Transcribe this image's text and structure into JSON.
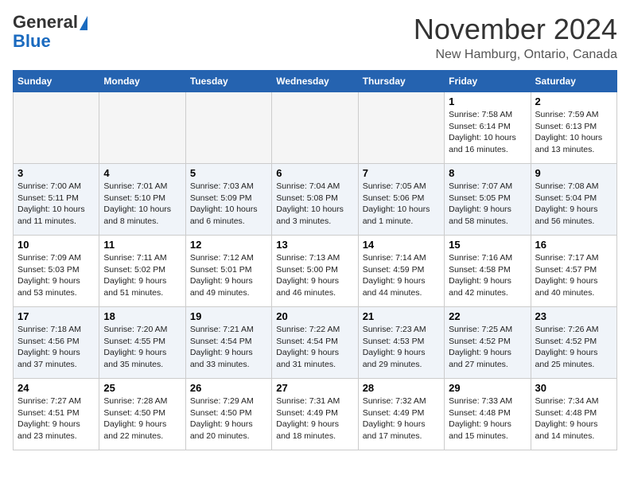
{
  "header": {
    "logo_line1": "General",
    "logo_line2": "Blue",
    "month": "November 2024",
    "location": "New Hamburg, Ontario, Canada"
  },
  "weekdays": [
    "Sunday",
    "Monday",
    "Tuesday",
    "Wednesday",
    "Thursday",
    "Friday",
    "Saturday"
  ],
  "weeks": [
    {
      "rowStyle": "row-white",
      "days": [
        {
          "num": "",
          "info": "",
          "empty": true
        },
        {
          "num": "",
          "info": "",
          "empty": true
        },
        {
          "num": "",
          "info": "",
          "empty": true
        },
        {
          "num": "",
          "info": "",
          "empty": true
        },
        {
          "num": "",
          "info": "",
          "empty": true
        },
        {
          "num": "1",
          "info": "Sunrise: 7:58 AM\nSunset: 6:14 PM\nDaylight: 10 hours\nand 16 minutes.",
          "empty": false
        },
        {
          "num": "2",
          "info": "Sunrise: 7:59 AM\nSunset: 6:13 PM\nDaylight: 10 hours\nand 13 minutes.",
          "empty": false
        }
      ]
    },
    {
      "rowStyle": "row-blue",
      "days": [
        {
          "num": "3",
          "info": "Sunrise: 7:00 AM\nSunset: 5:11 PM\nDaylight: 10 hours\nand 11 minutes.",
          "empty": false
        },
        {
          "num": "4",
          "info": "Sunrise: 7:01 AM\nSunset: 5:10 PM\nDaylight: 10 hours\nand 8 minutes.",
          "empty": false
        },
        {
          "num": "5",
          "info": "Sunrise: 7:03 AM\nSunset: 5:09 PM\nDaylight: 10 hours\nand 6 minutes.",
          "empty": false
        },
        {
          "num": "6",
          "info": "Sunrise: 7:04 AM\nSunset: 5:08 PM\nDaylight: 10 hours\nand 3 minutes.",
          "empty": false
        },
        {
          "num": "7",
          "info": "Sunrise: 7:05 AM\nSunset: 5:06 PM\nDaylight: 10 hours\nand 1 minute.",
          "empty": false
        },
        {
          "num": "8",
          "info": "Sunrise: 7:07 AM\nSunset: 5:05 PM\nDaylight: 9 hours\nand 58 minutes.",
          "empty": false
        },
        {
          "num": "9",
          "info": "Sunrise: 7:08 AM\nSunset: 5:04 PM\nDaylight: 9 hours\nand 56 minutes.",
          "empty": false
        }
      ]
    },
    {
      "rowStyle": "row-white",
      "days": [
        {
          "num": "10",
          "info": "Sunrise: 7:09 AM\nSunset: 5:03 PM\nDaylight: 9 hours\nand 53 minutes.",
          "empty": false
        },
        {
          "num": "11",
          "info": "Sunrise: 7:11 AM\nSunset: 5:02 PM\nDaylight: 9 hours\nand 51 minutes.",
          "empty": false
        },
        {
          "num": "12",
          "info": "Sunrise: 7:12 AM\nSunset: 5:01 PM\nDaylight: 9 hours\nand 49 minutes.",
          "empty": false
        },
        {
          "num": "13",
          "info": "Sunrise: 7:13 AM\nSunset: 5:00 PM\nDaylight: 9 hours\nand 46 minutes.",
          "empty": false
        },
        {
          "num": "14",
          "info": "Sunrise: 7:14 AM\nSunset: 4:59 PM\nDaylight: 9 hours\nand 44 minutes.",
          "empty": false
        },
        {
          "num": "15",
          "info": "Sunrise: 7:16 AM\nSunset: 4:58 PM\nDaylight: 9 hours\nand 42 minutes.",
          "empty": false
        },
        {
          "num": "16",
          "info": "Sunrise: 7:17 AM\nSunset: 4:57 PM\nDaylight: 9 hours\nand 40 minutes.",
          "empty": false
        }
      ]
    },
    {
      "rowStyle": "row-blue",
      "days": [
        {
          "num": "17",
          "info": "Sunrise: 7:18 AM\nSunset: 4:56 PM\nDaylight: 9 hours\nand 37 minutes.",
          "empty": false
        },
        {
          "num": "18",
          "info": "Sunrise: 7:20 AM\nSunset: 4:55 PM\nDaylight: 9 hours\nand 35 minutes.",
          "empty": false
        },
        {
          "num": "19",
          "info": "Sunrise: 7:21 AM\nSunset: 4:54 PM\nDaylight: 9 hours\nand 33 minutes.",
          "empty": false
        },
        {
          "num": "20",
          "info": "Sunrise: 7:22 AM\nSunset: 4:54 PM\nDaylight: 9 hours\nand 31 minutes.",
          "empty": false
        },
        {
          "num": "21",
          "info": "Sunrise: 7:23 AM\nSunset: 4:53 PM\nDaylight: 9 hours\nand 29 minutes.",
          "empty": false
        },
        {
          "num": "22",
          "info": "Sunrise: 7:25 AM\nSunset: 4:52 PM\nDaylight: 9 hours\nand 27 minutes.",
          "empty": false
        },
        {
          "num": "23",
          "info": "Sunrise: 7:26 AM\nSunset: 4:52 PM\nDaylight: 9 hours\nand 25 minutes.",
          "empty": false
        }
      ]
    },
    {
      "rowStyle": "row-white",
      "days": [
        {
          "num": "24",
          "info": "Sunrise: 7:27 AM\nSunset: 4:51 PM\nDaylight: 9 hours\nand 23 minutes.",
          "empty": false
        },
        {
          "num": "25",
          "info": "Sunrise: 7:28 AM\nSunset: 4:50 PM\nDaylight: 9 hours\nand 22 minutes.",
          "empty": false
        },
        {
          "num": "26",
          "info": "Sunrise: 7:29 AM\nSunset: 4:50 PM\nDaylight: 9 hours\nand 20 minutes.",
          "empty": false
        },
        {
          "num": "27",
          "info": "Sunrise: 7:31 AM\nSunset: 4:49 PM\nDaylight: 9 hours\nand 18 minutes.",
          "empty": false
        },
        {
          "num": "28",
          "info": "Sunrise: 7:32 AM\nSunset: 4:49 PM\nDaylight: 9 hours\nand 17 minutes.",
          "empty": false
        },
        {
          "num": "29",
          "info": "Sunrise: 7:33 AM\nSunset: 4:48 PM\nDaylight: 9 hours\nand 15 minutes.",
          "empty": false
        },
        {
          "num": "30",
          "info": "Sunrise: 7:34 AM\nSunset: 4:48 PM\nDaylight: 9 hours\nand 14 minutes.",
          "empty": false
        }
      ]
    }
  ]
}
